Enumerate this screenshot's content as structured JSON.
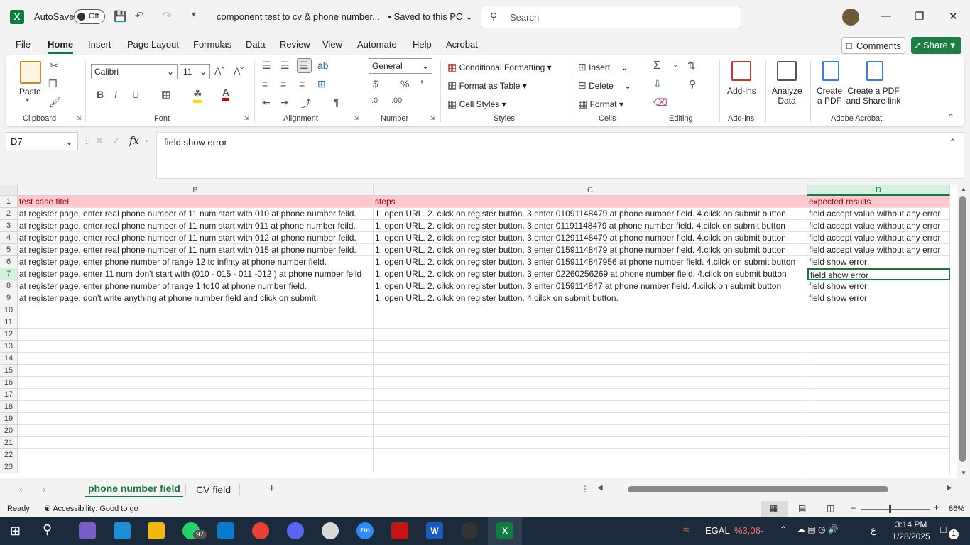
{
  "titlebar": {
    "autosave_label": "AutoSave",
    "autosave_state": "Off",
    "doc_title": "component test to cv & phone number...",
    "save_status": "• Saved to this PC",
    "search_placeholder": "Search"
  },
  "menu": {
    "items": [
      "File",
      "Home",
      "Insert",
      "Page Layout",
      "Formulas",
      "Data",
      "Review",
      "View",
      "Automate",
      "Help",
      "Acrobat"
    ],
    "comments": "Comments",
    "share": "Share"
  },
  "ribbon": {
    "clipboard": {
      "paste": "Paste",
      "label": "Clipboard"
    },
    "font": {
      "name": "Calibri",
      "size": "11",
      "label": "Font"
    },
    "alignment": {
      "label": "Alignment"
    },
    "number": {
      "format": "General",
      "label": "Number"
    },
    "styles": {
      "conditional": "Conditional Formatting",
      "format_table": "Format as Table",
      "cell_styles": "Cell Styles",
      "label": "Styles"
    },
    "cells": {
      "insert": "Insert",
      "delete": "Delete",
      "format": "Format",
      "label": "Cells"
    },
    "editing": {
      "label": "Editing"
    },
    "addins": {
      "btn": "Add-ins",
      "label": "Add-ins"
    },
    "analyze": {
      "line1": "Analyze",
      "line2": "Data"
    },
    "acrobat": {
      "create1": "Create",
      "create2": "a PDF",
      "share1": "Create a PDF",
      "share2": "and Share link",
      "label": "Adobe Acrobat"
    }
  },
  "formula_bar": {
    "name_box": "D7",
    "fx": "fx",
    "content": "field show error"
  },
  "grid": {
    "columns": [
      "B",
      "C",
      "D"
    ],
    "rows": [
      {
        "n": "1",
        "b": "test case titel",
        "c": "steps",
        "d": "expected results"
      },
      {
        "n": "2",
        "b": "at register page, enter real phone number of 11 num  start with 010 at phone number feild.",
        "c": "1. open URL. 2. cilck on register button. 3.enter 01091148479 at phone number field. 4.cilck on submit button",
        "d": "field accept value without any error"
      },
      {
        "n": "3",
        "b": "at register page, enter real phone number of 11 num  start with 011 at phone number feild.",
        "c": "1. open URL. 2. cilck on register button. 3.enter 01191148479 at phone number field. 4.cilck on submit button",
        "d": "field accept value without any error"
      },
      {
        "n": "4",
        "b": "at register page, enter real  phone number of 11 num  start with 012 at phone number feild.",
        "c": "1. open URL. 2. cilck on register button. 3.enter 01291148479 at phone number field. 4.cilck on submit button",
        "d": "field accept value without any error"
      },
      {
        "n": "5",
        "b": "at register page, enter real phone number of 11 num  start with 015 at phone number feild.",
        "c": "1. open URL. 2. cilck on register button. 3.enter 01591148479 at phone number field. 4.cilck on submit button",
        "d": "field accept value without any error"
      },
      {
        "n": "6",
        "b": "at register page, enter  phone number of range 12 to infinty  at phone number field.",
        "c": "1. open URL. 2. cilck on register button. 3.enter 0159114847956 at phone number field. 4.cilck on submit button",
        "d": "field show error"
      },
      {
        "n": "7",
        "b": "at register page, enter 11 num don't start with (010 - 015 - 011 -012 ) at phone number feild",
        "c": "1. open URL. 2. cilck on register button. 3.enter 02260256269 at phone number field. 4.cilck on submit button",
        "d": "field show error"
      },
      {
        "n": "8",
        "b": "at register page, enter  phone number of range 1 to10 at phone number field.",
        "c": "1. open URL. 2. cilck on register button. 3.enter 0159114847 at phone number field. 4.cilck on submit button",
        "d": "field show error"
      },
      {
        "n": "9",
        "b": "at register page, don't write anything at phone number field and click on submit.",
        "c": "1. open URL. 2. cilck on register button. 4.cilck on submit button.",
        "d": "field show error"
      }
    ],
    "empty_rows": [
      "10",
      "11",
      "12",
      "13",
      "14",
      "15",
      "16",
      "17",
      "18",
      "19",
      "20",
      "21",
      "22",
      "23"
    ]
  },
  "sheets": {
    "active": "phone number field",
    "other": "CV field",
    "add": "+"
  },
  "status": {
    "ready": "Ready",
    "accessibility": "Accessibility: Good to go",
    "zoom": "86%"
  },
  "taskbar": {
    "whatsapp_badge": "97",
    "stock": "EGAL",
    "stock_change": "%3,06-",
    "lang": "ع",
    "time": "3:14 PM",
    "date": "1/28/2025",
    "notif": "1"
  }
}
